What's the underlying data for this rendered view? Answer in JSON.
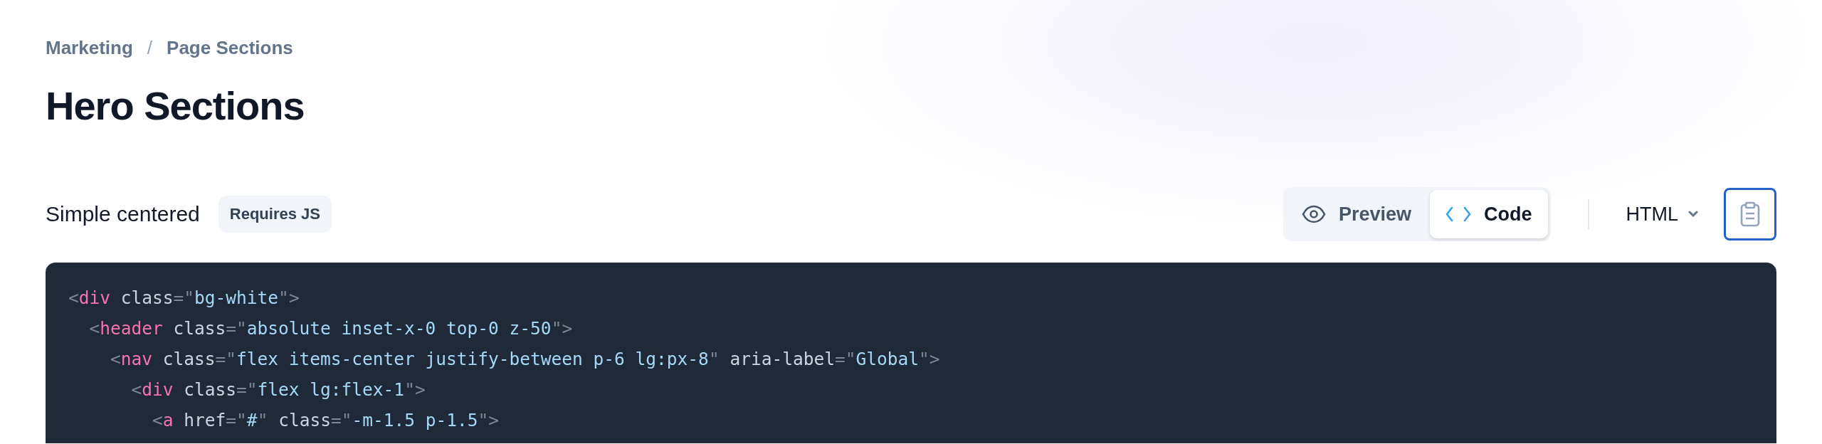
{
  "breadcrumb": [
    {
      "kind": "link",
      "text": "Marketing"
    },
    {
      "kind": "separator",
      "text": "/"
    },
    {
      "kind": "link",
      "text": "Page Sections"
    }
  ],
  "title": "Hero Sections",
  "example": {
    "name": "Simple centered",
    "badge": "Requires JS"
  },
  "view_tabs": [
    {
      "label": "Preview",
      "kind": "preview",
      "selected": false
    },
    {
      "label": "Code",
      "kind": "code",
      "selected": true
    }
  ],
  "language": {
    "label": "HTML"
  },
  "code_lines": [
    "<div class=\"bg-white\">",
    "  <header class=\"absolute inset-x-0 top-0 z-50\">",
    "    <nav class=\"flex items-center justify-between p-6 lg:px-8\" aria-label=\"Global\">",
    "      <div class=\"flex lg:flex-1\">",
    "        <a href=\"#\" class=\"-m-1.5 p-1.5\">"
  ]
}
